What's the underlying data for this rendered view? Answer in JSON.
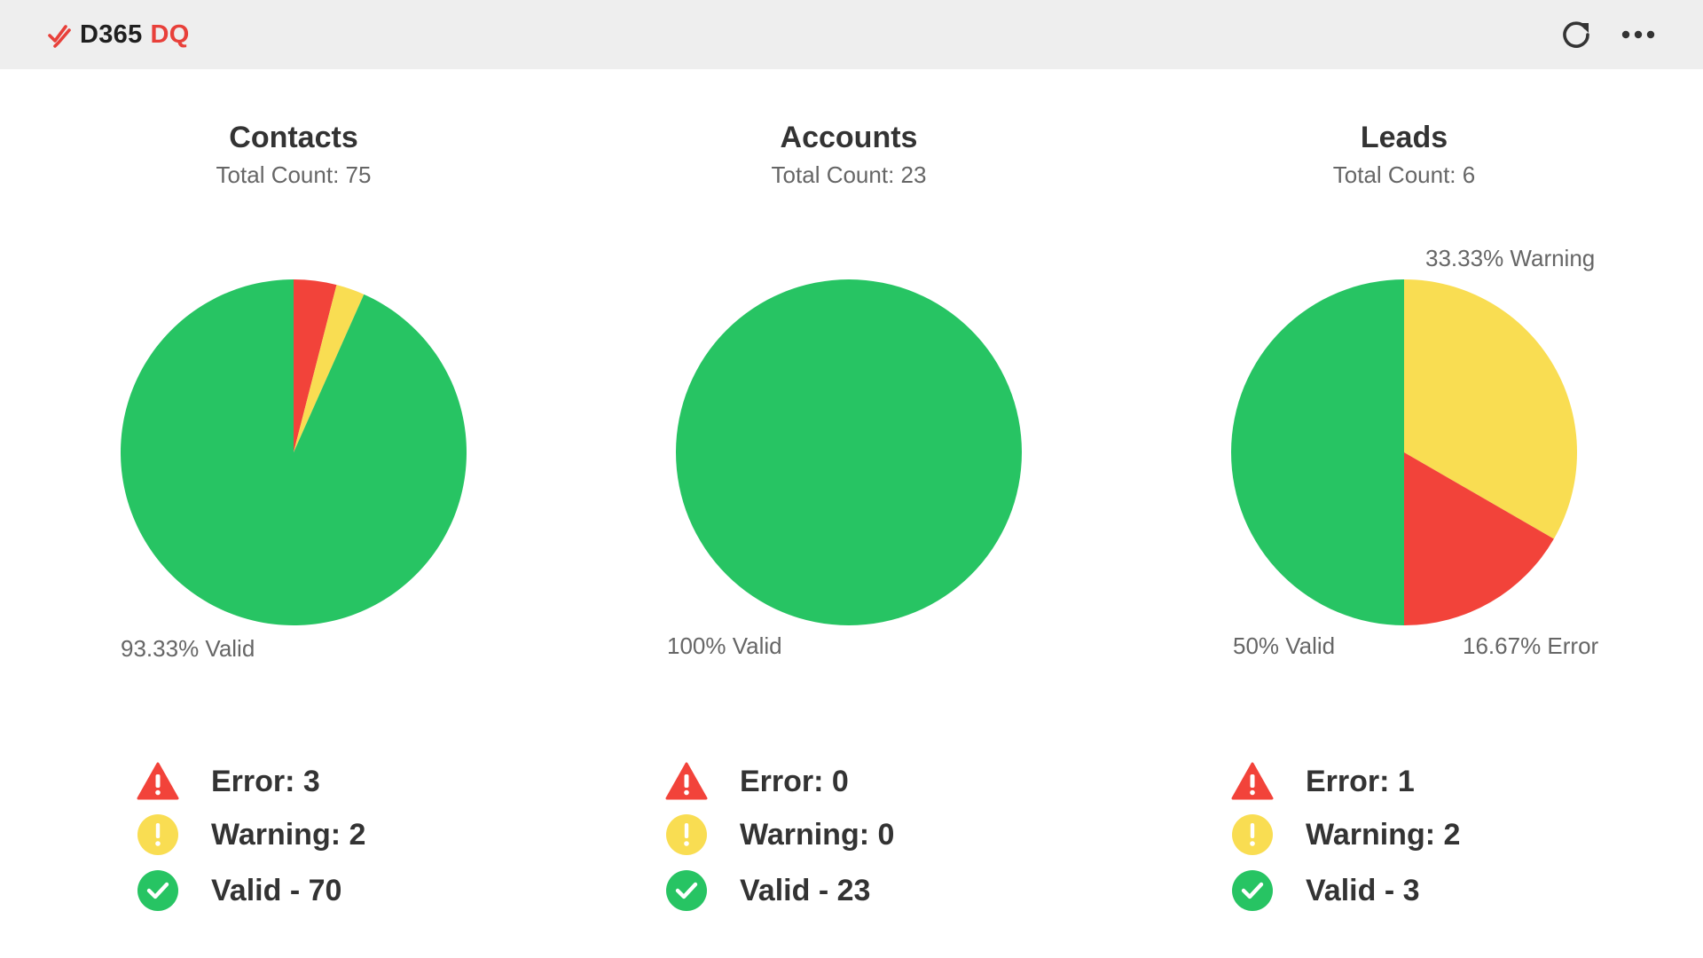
{
  "header": {
    "brand_main": "D365",
    "brand_accent": "DQ",
    "brand_color": "#e8403a",
    "icons": [
      "check-logo-icon",
      "refresh-icon",
      "more-icon"
    ]
  },
  "colors": {
    "error": "#f2433a",
    "warning": "#f9dd52",
    "valid": "#27c463"
  },
  "panels": [
    {
      "title": "Contacts",
      "subtitle": "Total Count: 75",
      "valid_label": "93.33% Valid",
      "warning_label": "",
      "error_label": "",
      "legend": {
        "error": "Error: 3",
        "warning": "Warning: 2",
        "valid": "Valid - 70"
      }
    },
    {
      "title": "Accounts",
      "subtitle": "Total Count: 23",
      "valid_label": "100% Valid",
      "warning_label": "",
      "error_label": "",
      "legend": {
        "error": "Error: 0",
        "warning": "Warning: 0",
        "valid": "Valid - 23"
      }
    },
    {
      "title": "Leads",
      "subtitle": "Total Count: 6",
      "valid_label": "50% Valid",
      "warning_label": "33.33% Warning",
      "error_label": "16.67% Error",
      "legend": {
        "error": "Error: 1",
        "warning": "Warning: 2",
        "valid": "Valid - 3"
      }
    }
  ],
  "chart_data": [
    {
      "type": "pie",
      "title": "Contacts",
      "subtitle": "Total Count: 75",
      "categories": [
        "Error",
        "Warning",
        "Valid"
      ],
      "values": [
        3,
        2,
        70
      ],
      "slice_labels": [
        "",
        "",
        "93.33% Valid"
      ],
      "colors": [
        "#f2433a",
        "#f9dd52",
        "#27c463"
      ]
    },
    {
      "type": "pie",
      "title": "Accounts",
      "subtitle": "Total Count: 23",
      "categories": [
        "Error",
        "Warning",
        "Valid"
      ],
      "values": [
        0,
        0,
        23
      ],
      "slice_labels": [
        "",
        "",
        "100% Valid"
      ],
      "colors": [
        "#f2433a",
        "#f9dd52",
        "#27c463"
      ]
    },
    {
      "type": "pie",
      "title": "Leads",
      "subtitle": "Total Count: 6",
      "categories": [
        "Warning",
        "Error",
        "Valid"
      ],
      "values": [
        2,
        1,
        3
      ],
      "slice_labels": [
        "33.33% Warning",
        "16.67% Error",
        "50% Valid"
      ],
      "colors": [
        "#f9dd52",
        "#f2433a",
        "#27c463"
      ]
    }
  ]
}
